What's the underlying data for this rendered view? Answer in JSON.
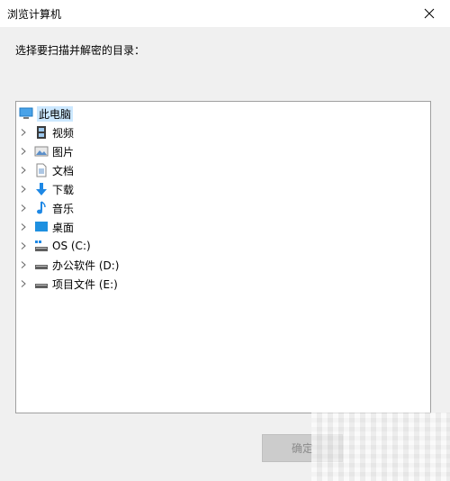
{
  "window": {
    "title": "浏览计算机"
  },
  "prompt": "选择要扫描并解密的目录：",
  "tree": {
    "root": {
      "label": "此电脑",
      "icon": "computer-icon"
    },
    "items": [
      {
        "label": "视频",
        "icon": "video-folder-icon"
      },
      {
        "label": "图片",
        "icon": "pictures-folder-icon"
      },
      {
        "label": "文档",
        "icon": "documents-folder-icon"
      },
      {
        "label": "下载",
        "icon": "download-icon"
      },
      {
        "label": "音乐",
        "icon": "music-icon"
      },
      {
        "label": "桌面",
        "icon": "desktop-icon"
      },
      {
        "label": "OS (C:)",
        "icon": "system-drive-icon"
      },
      {
        "label": "办公软件 (D:)",
        "icon": "drive-icon"
      },
      {
        "label": "项目文件 (E:)",
        "icon": "drive-icon"
      }
    ]
  },
  "buttons": {
    "ok": "确定"
  },
  "colors": {
    "selection": "#cce8ff",
    "accent": "#1e88e5"
  }
}
